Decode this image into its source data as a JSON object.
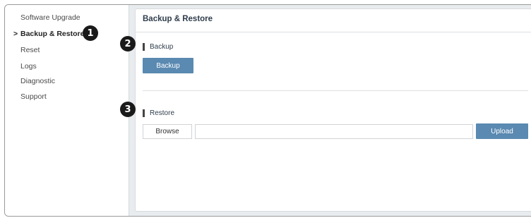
{
  "sidebar": {
    "items": [
      {
        "label": "Software Upgrade",
        "active": false
      },
      {
        "label": "Backup & Restore",
        "active": true
      },
      {
        "label": "Reset",
        "active": false
      },
      {
        "label": "Logs",
        "active": false
      },
      {
        "label": "Diagnostic",
        "active": false
      },
      {
        "label": "Support",
        "active": false
      }
    ],
    "active_marker": ">"
  },
  "callouts": [
    "1",
    "2",
    "3"
  ],
  "panel": {
    "title": "Backup & Restore",
    "backup": {
      "heading": "Backup",
      "button_label": "Backup"
    },
    "restore": {
      "heading": "Restore",
      "browse_label": "Browse",
      "file_value": "",
      "upload_label": "Upload"
    }
  },
  "colors": {
    "accent": "#5a89b1",
    "callout": "#1a1a1a",
    "panel_bg": "#e9ecef"
  }
}
